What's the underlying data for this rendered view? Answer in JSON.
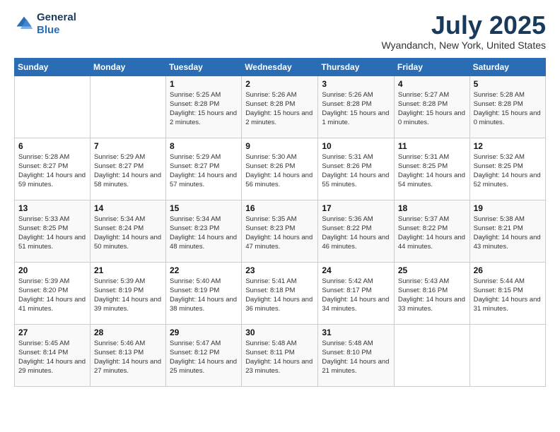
{
  "header": {
    "logo_line1": "General",
    "logo_line2": "Blue",
    "month": "July 2025",
    "location": "Wyandanch, New York, United States"
  },
  "days_of_week": [
    "Sunday",
    "Monday",
    "Tuesday",
    "Wednesday",
    "Thursday",
    "Friday",
    "Saturday"
  ],
  "weeks": [
    [
      {
        "day": "",
        "text": ""
      },
      {
        "day": "",
        "text": ""
      },
      {
        "day": "1",
        "text": "Sunrise: 5:25 AM\nSunset: 8:28 PM\nDaylight: 15 hours and 2 minutes."
      },
      {
        "day": "2",
        "text": "Sunrise: 5:26 AM\nSunset: 8:28 PM\nDaylight: 15 hours and 2 minutes."
      },
      {
        "day": "3",
        "text": "Sunrise: 5:26 AM\nSunset: 8:28 PM\nDaylight: 15 hours and 1 minute."
      },
      {
        "day": "4",
        "text": "Sunrise: 5:27 AM\nSunset: 8:28 PM\nDaylight: 15 hours and 0 minutes."
      },
      {
        "day": "5",
        "text": "Sunrise: 5:28 AM\nSunset: 8:28 PM\nDaylight: 15 hours and 0 minutes."
      }
    ],
    [
      {
        "day": "6",
        "text": "Sunrise: 5:28 AM\nSunset: 8:27 PM\nDaylight: 14 hours and 59 minutes."
      },
      {
        "day": "7",
        "text": "Sunrise: 5:29 AM\nSunset: 8:27 PM\nDaylight: 14 hours and 58 minutes."
      },
      {
        "day": "8",
        "text": "Sunrise: 5:29 AM\nSunset: 8:27 PM\nDaylight: 14 hours and 57 minutes."
      },
      {
        "day": "9",
        "text": "Sunrise: 5:30 AM\nSunset: 8:26 PM\nDaylight: 14 hours and 56 minutes."
      },
      {
        "day": "10",
        "text": "Sunrise: 5:31 AM\nSunset: 8:26 PM\nDaylight: 14 hours and 55 minutes."
      },
      {
        "day": "11",
        "text": "Sunrise: 5:31 AM\nSunset: 8:25 PM\nDaylight: 14 hours and 54 minutes."
      },
      {
        "day": "12",
        "text": "Sunrise: 5:32 AM\nSunset: 8:25 PM\nDaylight: 14 hours and 52 minutes."
      }
    ],
    [
      {
        "day": "13",
        "text": "Sunrise: 5:33 AM\nSunset: 8:25 PM\nDaylight: 14 hours and 51 minutes."
      },
      {
        "day": "14",
        "text": "Sunrise: 5:34 AM\nSunset: 8:24 PM\nDaylight: 14 hours and 50 minutes."
      },
      {
        "day": "15",
        "text": "Sunrise: 5:34 AM\nSunset: 8:23 PM\nDaylight: 14 hours and 48 minutes."
      },
      {
        "day": "16",
        "text": "Sunrise: 5:35 AM\nSunset: 8:23 PM\nDaylight: 14 hours and 47 minutes."
      },
      {
        "day": "17",
        "text": "Sunrise: 5:36 AM\nSunset: 8:22 PM\nDaylight: 14 hours and 46 minutes."
      },
      {
        "day": "18",
        "text": "Sunrise: 5:37 AM\nSunset: 8:22 PM\nDaylight: 14 hours and 44 minutes."
      },
      {
        "day": "19",
        "text": "Sunrise: 5:38 AM\nSunset: 8:21 PM\nDaylight: 14 hours and 43 minutes."
      }
    ],
    [
      {
        "day": "20",
        "text": "Sunrise: 5:39 AM\nSunset: 8:20 PM\nDaylight: 14 hours and 41 minutes."
      },
      {
        "day": "21",
        "text": "Sunrise: 5:39 AM\nSunset: 8:19 PM\nDaylight: 14 hours and 39 minutes."
      },
      {
        "day": "22",
        "text": "Sunrise: 5:40 AM\nSunset: 8:19 PM\nDaylight: 14 hours and 38 minutes."
      },
      {
        "day": "23",
        "text": "Sunrise: 5:41 AM\nSunset: 8:18 PM\nDaylight: 14 hours and 36 minutes."
      },
      {
        "day": "24",
        "text": "Sunrise: 5:42 AM\nSunset: 8:17 PM\nDaylight: 14 hours and 34 minutes."
      },
      {
        "day": "25",
        "text": "Sunrise: 5:43 AM\nSunset: 8:16 PM\nDaylight: 14 hours and 33 minutes."
      },
      {
        "day": "26",
        "text": "Sunrise: 5:44 AM\nSunset: 8:15 PM\nDaylight: 14 hours and 31 minutes."
      }
    ],
    [
      {
        "day": "27",
        "text": "Sunrise: 5:45 AM\nSunset: 8:14 PM\nDaylight: 14 hours and 29 minutes."
      },
      {
        "day": "28",
        "text": "Sunrise: 5:46 AM\nSunset: 8:13 PM\nDaylight: 14 hours and 27 minutes."
      },
      {
        "day": "29",
        "text": "Sunrise: 5:47 AM\nSunset: 8:12 PM\nDaylight: 14 hours and 25 minutes."
      },
      {
        "day": "30",
        "text": "Sunrise: 5:48 AM\nSunset: 8:11 PM\nDaylight: 14 hours and 23 minutes."
      },
      {
        "day": "31",
        "text": "Sunrise: 5:48 AM\nSunset: 8:10 PM\nDaylight: 14 hours and 21 minutes."
      },
      {
        "day": "",
        "text": ""
      },
      {
        "day": "",
        "text": ""
      }
    ]
  ]
}
